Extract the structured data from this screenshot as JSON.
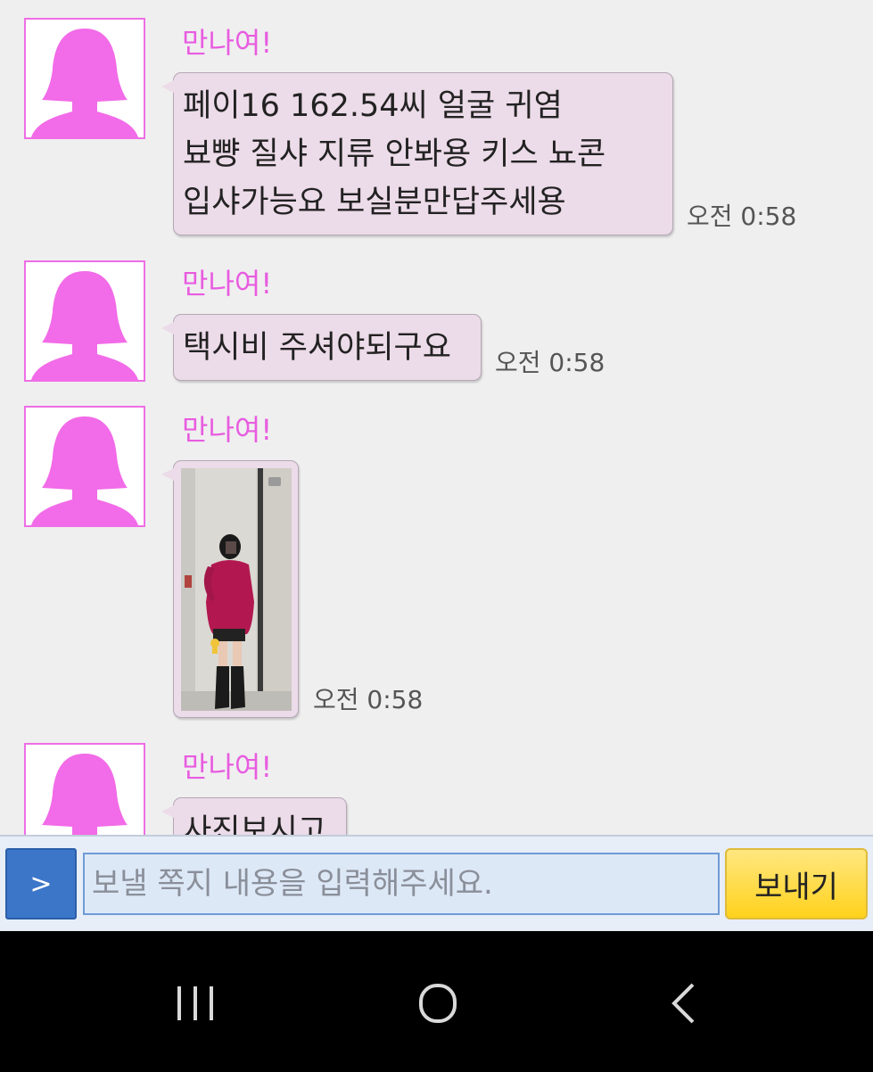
{
  "messages": [
    {
      "sender": "만나여!",
      "lines": [
        "페이16 162.54씨 얼굴 귀염",
        "뵤뺭 질샤 지류 안봐용 키스 뇨콘",
        "입샤가능요 보실분만답주세용"
      ],
      "time": "오전 0:58"
    },
    {
      "sender": "만나여!",
      "lines": [
        "택시비 주셔야되구요"
      ],
      "time": "오전 0:58"
    },
    {
      "sender": "만나여!",
      "photo": "mirror-selfie-photo",
      "time": "오전 0:58"
    },
    {
      "sender": "만나여!",
      "lines": [
        "사진보시고"
      ]
    }
  ],
  "composer": {
    "menu_label": ">",
    "input_placeholder": "보낼 쪽지 내용을 입력해주세요.",
    "input_value": "",
    "send_label": "보내기"
  },
  "nav": {
    "recent_icon": "recent-apps-icon",
    "home_icon": "home-icon",
    "back_icon": "back-icon"
  },
  "colors": {
    "sender": "#e85ce0",
    "avatar": "#f26be8",
    "bubble": "#ecdbe8",
    "send_button": "#ffd21c",
    "menu_button": "#3c76c8"
  }
}
